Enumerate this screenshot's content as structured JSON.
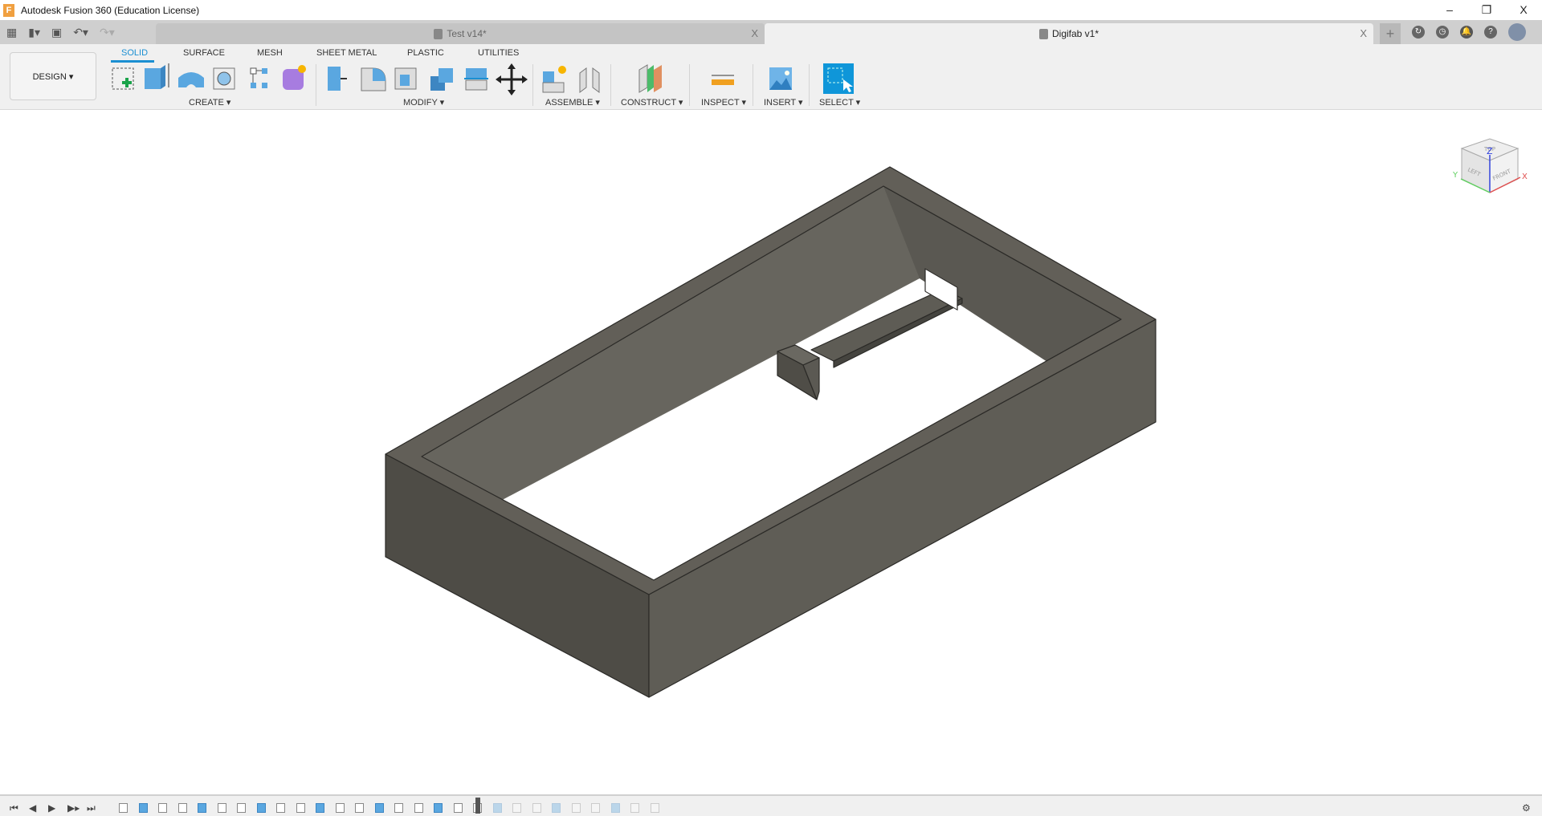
{
  "app": {
    "title": "Autodesk Fusion 360 (Education License)",
    "logo": "F"
  },
  "window_controls": {
    "minimize": "–",
    "restore": "❐",
    "close": "X"
  },
  "document_tabs": [
    {
      "label": "Test v14*",
      "close": "X",
      "active": false
    },
    {
      "label": "Digifab v1*",
      "close": "X",
      "active": true
    }
  ],
  "toolbar": {
    "workspace": "DESIGN ▾",
    "tabs": [
      "SOLID",
      "SURFACE",
      "MESH",
      "SHEET METAL",
      "PLASTIC",
      "UTILITIES"
    ],
    "active_tab": "SOLID",
    "groups": [
      "CREATE ▾",
      "MODIFY ▾",
      "ASSEMBLE ▾",
      "CONSTRUCT ▾",
      "INSPECT ▾",
      "INSERT ▾",
      "SELECT ▾"
    ],
    "accent": "#1b8fd2"
  },
  "viewcube": {
    "top": "TOP",
    "left": "LEFT",
    "front": "FRONT",
    "axes": {
      "x": "X",
      "y": "Y",
      "z": "Z"
    }
  },
  "model": {
    "color": "#5e5c55",
    "edge": "#2b2a27"
  },
  "settings_icon": "⚙"
}
